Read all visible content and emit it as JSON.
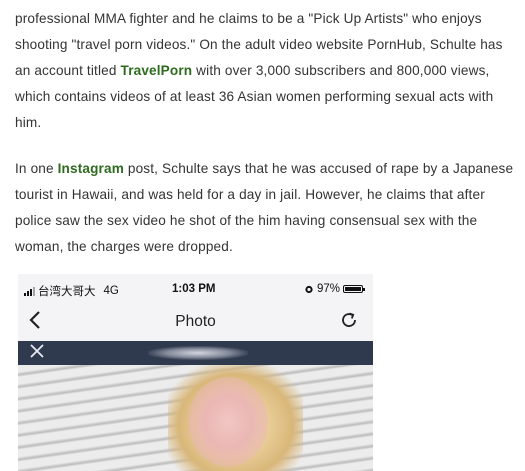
{
  "article": {
    "p1": {
      "a": "professional MMA fighter and he claims to be a \"Pick Up Artists\" who enjoys shooting \"travel porn videos.\" On the adult video website PornHub, Schulte has an account titled ",
      "hl": "TravelPorn",
      "b": " with over 3,000 subscribers and 800,000 views, which contains videos of at least 36 Asian women performing sexual acts with him."
    },
    "p2": {
      "a": "In one ",
      "hl": "Instagram",
      "b": " post, Schulte says that he was accused of rape by a Japanese tourist in Hawaii, and was held for a day in jail. However, he claims that after police saw the sex video he shot of the him having consensual sex with the woman, the charges were dropped."
    }
  },
  "screenshot": {
    "status": {
      "carrier": "台湾大哥大",
      "network": "4G",
      "time": "1:03 PM",
      "battery": "97%",
      "battery_level": 0.97
    },
    "nav": {
      "back_icon": "chevron-left-icon",
      "title": "Photo",
      "refresh_icon": "refresh-icon"
    },
    "close_icon": "close-icon"
  },
  "colors": {
    "highlight": "#2e6b1f",
    "text": "#333333",
    "dark_bar": "#303a4f"
  }
}
